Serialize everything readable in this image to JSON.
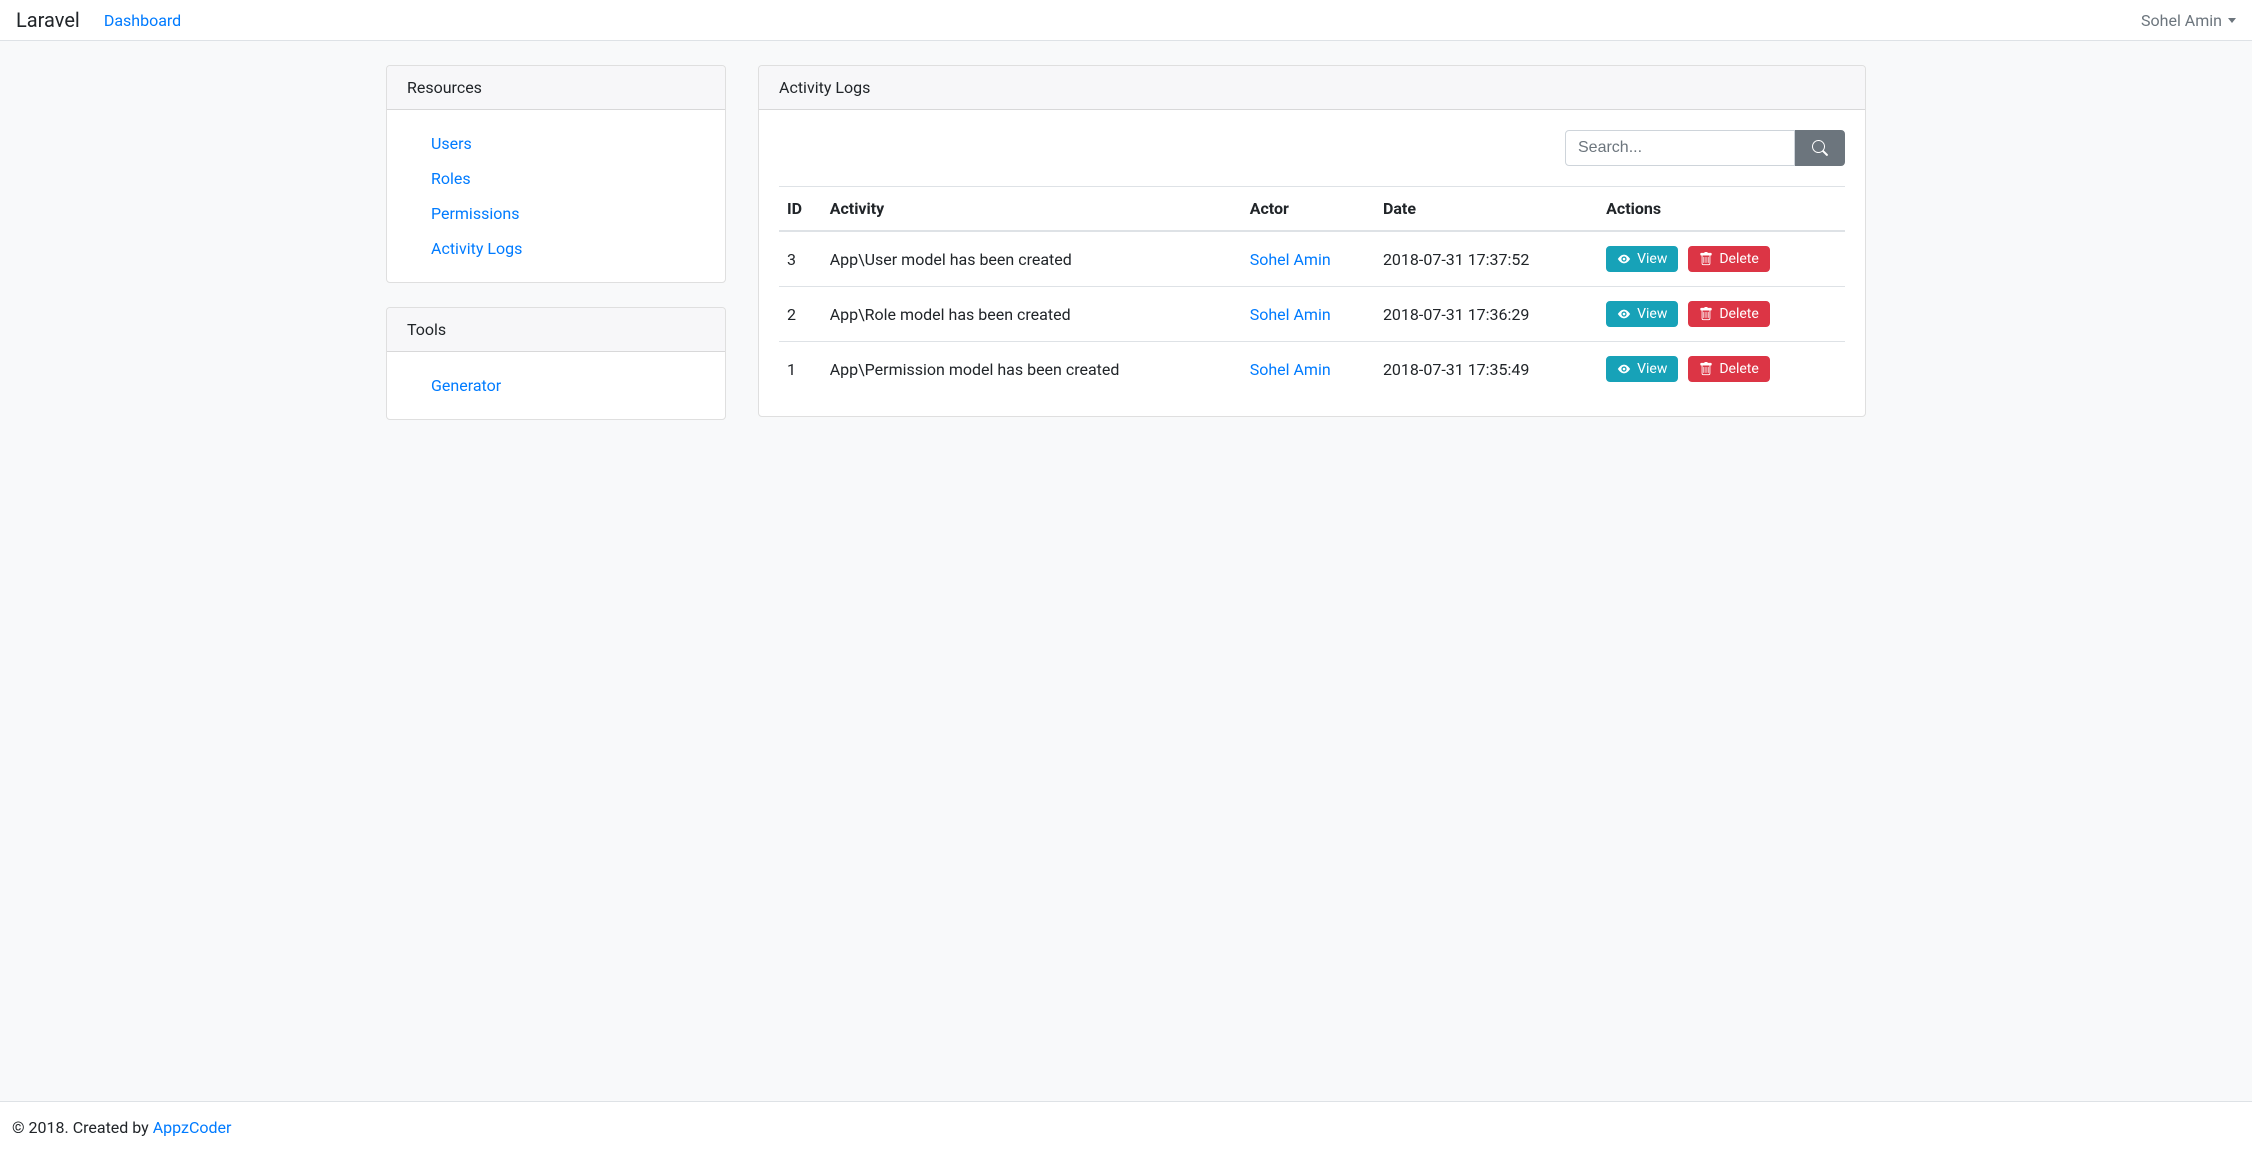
{
  "navbar": {
    "brand": "Laravel",
    "dashboard": "Dashboard",
    "user": "Sohel Amin"
  },
  "sidebar": {
    "resources": {
      "title": "Resources",
      "items": [
        {
          "label": "Users"
        },
        {
          "label": "Roles"
        },
        {
          "label": "Permissions"
        },
        {
          "label": "Activity Logs"
        }
      ]
    },
    "tools": {
      "title": "Tools",
      "items": [
        {
          "label": "Generator"
        }
      ]
    }
  },
  "main": {
    "title": "Activity Logs",
    "search": {
      "placeholder": "Search..."
    },
    "table": {
      "headers": {
        "id": "ID",
        "activity": "Activity",
        "actor": "Actor",
        "date": "Date",
        "actions": "Actions"
      },
      "rows": [
        {
          "id": "3",
          "activity": "App\\User model has been created",
          "actor": "Sohel Amin",
          "date": "2018-07-31 17:37:52"
        },
        {
          "id": "2",
          "activity": "App\\Role model has been created",
          "actor": "Sohel Amin",
          "date": "2018-07-31 17:36:29"
        },
        {
          "id": "1",
          "activity": "App\\Permission model has been created",
          "actor": "Sohel Amin",
          "date": "2018-07-31 17:35:49"
        }
      ]
    },
    "buttons": {
      "view": "View",
      "delete": "Delete"
    }
  },
  "footer": {
    "prefix": "© 2018. Created by ",
    "link_label": "AppzCoder"
  }
}
